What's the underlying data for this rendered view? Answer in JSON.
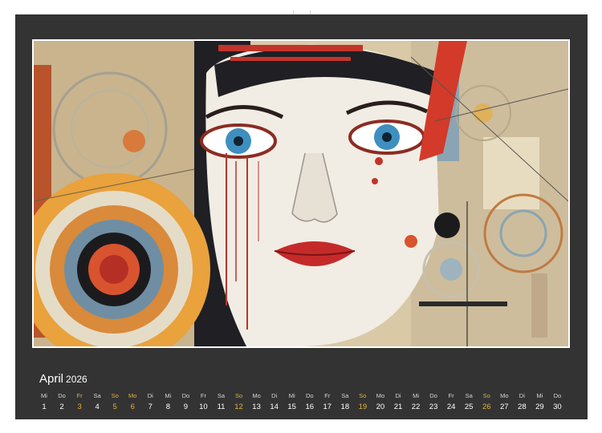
{
  "calendar": {
    "month": "April",
    "year": "2026",
    "highlight_color": "#e3b23c",
    "days": [
      {
        "wd": "Mi",
        "d": "1",
        "hl": false
      },
      {
        "wd": "Do",
        "d": "2",
        "hl": false
      },
      {
        "wd": "Fr",
        "d": "3",
        "hl": true
      },
      {
        "wd": "Sa",
        "d": "4",
        "hl": false
      },
      {
        "wd": "So",
        "d": "5",
        "hl": true
      },
      {
        "wd": "Mo",
        "d": "6",
        "hl": true
      },
      {
        "wd": "Di",
        "d": "7",
        "hl": false
      },
      {
        "wd": "Mi",
        "d": "8",
        "hl": false
      },
      {
        "wd": "Do",
        "d": "9",
        "hl": false
      },
      {
        "wd": "Fr",
        "d": "10",
        "hl": false
      },
      {
        "wd": "Sa",
        "d": "11",
        "hl": false
      },
      {
        "wd": "So",
        "d": "12",
        "hl": true
      },
      {
        "wd": "Mo",
        "d": "13",
        "hl": false
      },
      {
        "wd": "Di",
        "d": "14",
        "hl": false
      },
      {
        "wd": "Mi",
        "d": "15",
        "hl": false
      },
      {
        "wd": "Do",
        "d": "16",
        "hl": false
      },
      {
        "wd": "Fr",
        "d": "17",
        "hl": false
      },
      {
        "wd": "Sa",
        "d": "18",
        "hl": false
      },
      {
        "wd": "So",
        "d": "19",
        "hl": true
      },
      {
        "wd": "Mo",
        "d": "20",
        "hl": false
      },
      {
        "wd": "Di",
        "d": "21",
        "hl": false
      },
      {
        "wd": "Mi",
        "d": "22",
        "hl": false
      },
      {
        "wd": "Do",
        "d": "23",
        "hl": false
      },
      {
        "wd": "Fr",
        "d": "24",
        "hl": false
      },
      {
        "wd": "Sa",
        "d": "25",
        "hl": false
      },
      {
        "wd": "So",
        "d": "26",
        "hl": true
      },
      {
        "wd": "Mo",
        "d": "27",
        "hl": false
      },
      {
        "wd": "Di",
        "d": "28",
        "hl": false
      },
      {
        "wd": "Mi",
        "d": "29",
        "hl": false
      },
      {
        "wd": "Do",
        "d": "30",
        "hl": false
      }
    ]
  }
}
